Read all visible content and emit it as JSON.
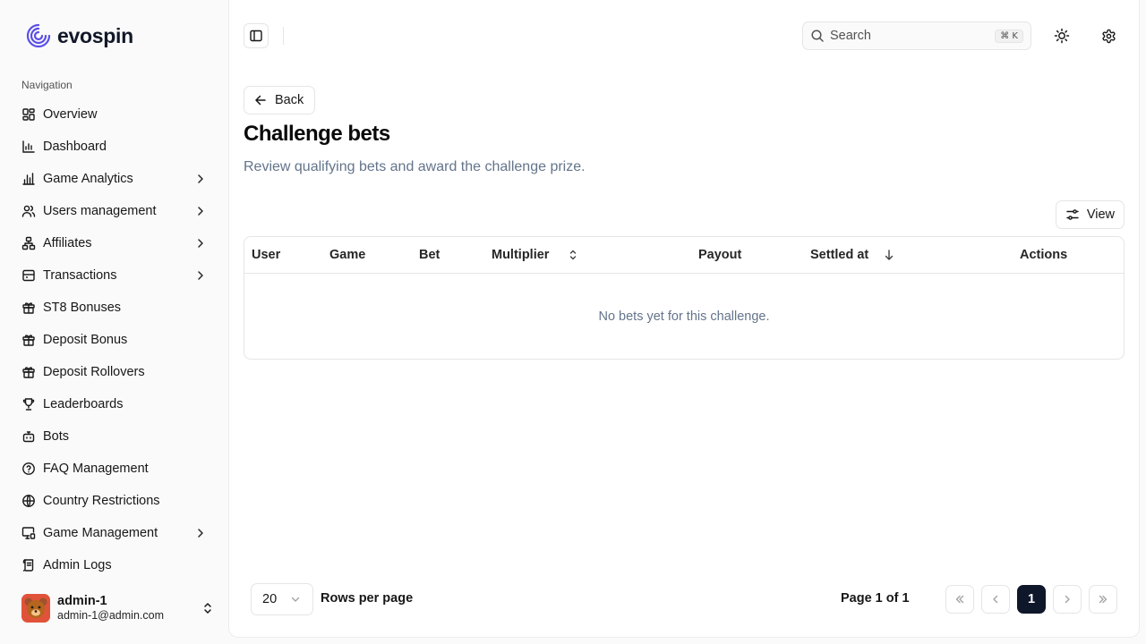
{
  "brand": {
    "name": "evospin",
    "logo_icon": "swirl-logo-icon",
    "accent": "#5b4ee6"
  },
  "sidebar": {
    "section_label": "Navigation",
    "items": [
      {
        "label": "Overview",
        "icon": "grid-icon",
        "has_children": false
      },
      {
        "label": "Dashboard",
        "icon": "bar-chart-icon",
        "has_children": false
      },
      {
        "label": "Game Analytics",
        "icon": "analytics-icon",
        "has_children": true
      },
      {
        "label": "Users management",
        "icon": "users-icon",
        "has_children": true
      },
      {
        "label": "Affiliates",
        "icon": "network-icon",
        "has_children": true
      },
      {
        "label": "Transactions",
        "icon": "wallet-icon",
        "has_children": true
      },
      {
        "label": "ST8 Bonuses",
        "icon": "gift-icon",
        "has_children": false
      },
      {
        "label": "Deposit Bonus",
        "icon": "gift-icon",
        "has_children": false
      },
      {
        "label": "Deposit Rollovers",
        "icon": "gift-icon",
        "has_children": false
      },
      {
        "label": "Leaderboards",
        "icon": "trophy-icon",
        "has_children": false
      },
      {
        "label": "Bots",
        "icon": "bot-icon",
        "has_children": false
      },
      {
        "label": "FAQ Management",
        "icon": "help-circle-icon",
        "has_children": false
      },
      {
        "label": "Country Restrictions",
        "icon": "globe-icon",
        "has_children": false
      },
      {
        "label": "Game Management",
        "icon": "monitor-icon",
        "has_children": true
      },
      {
        "label": "Admin Logs",
        "icon": "scroll-icon",
        "has_children": false
      }
    ],
    "user": {
      "name": "admin-1",
      "email": "admin-1@admin.com"
    }
  },
  "header": {
    "search": {
      "placeholder": "Search",
      "shortcut": "⌘ K"
    }
  },
  "page": {
    "back_label": "Back",
    "title": "Challenge bets",
    "subtitle": "Review qualifying bets and award the challenge prize.",
    "view_label": "View"
  },
  "table": {
    "columns": [
      "User",
      "Game",
      "Bet",
      "Multiplier",
      "Payout",
      "Settled at",
      "Actions"
    ],
    "empty_message": "No bets yet for this challenge."
  },
  "pagination": {
    "rows_per_page": "20",
    "rows_label": "Rows per page",
    "page_info": "Page 1 of 1",
    "current_page": "1"
  }
}
